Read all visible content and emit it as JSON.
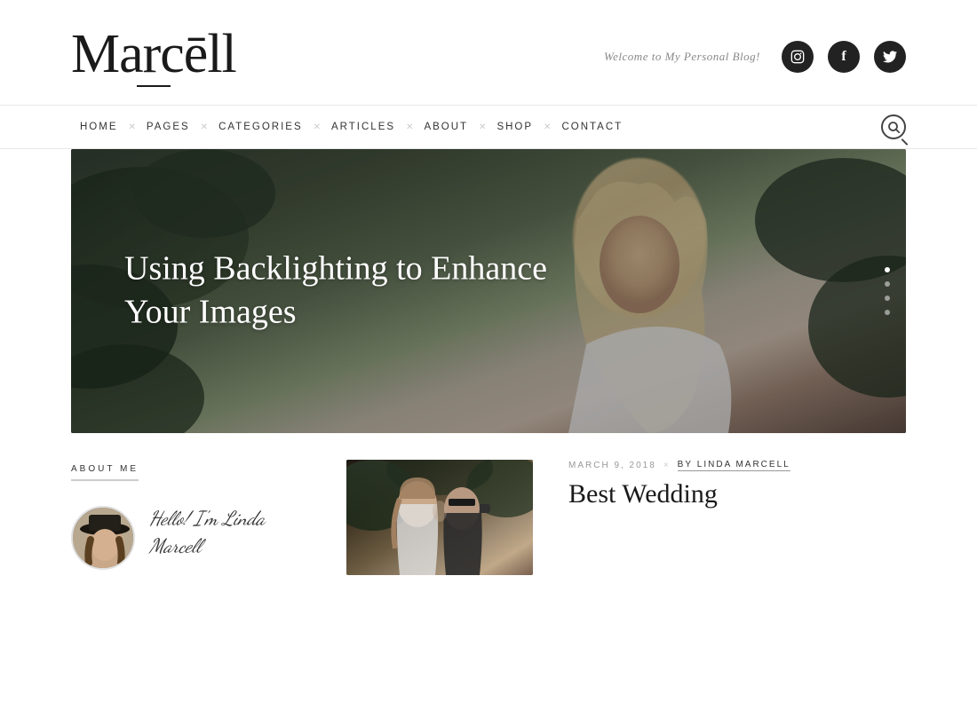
{
  "site": {
    "logo": "Marcēll",
    "tagline": "Welcome to My Personal Blog!",
    "social": [
      {
        "name": "instagram",
        "icon": "📷"
      },
      {
        "name": "facebook",
        "icon": "f"
      },
      {
        "name": "twitter",
        "icon": "🐦"
      }
    ]
  },
  "nav": {
    "items": [
      {
        "label": "HOME"
      },
      {
        "label": "PAGES"
      },
      {
        "label": "CATEGORIES"
      },
      {
        "label": "ARTICLES"
      },
      {
        "label": "ABOUT"
      },
      {
        "label": "SHOP"
      },
      {
        "label": "CONTACT"
      }
    ]
  },
  "hero": {
    "title": "Using Backlighting to Enhance Your Images",
    "dots": [
      {
        "active": true
      },
      {
        "active": false
      },
      {
        "active": false
      },
      {
        "active": false
      }
    ]
  },
  "about": {
    "label": "ABOUT ME",
    "greeting_line1": "Hello! I'm Linda",
    "greeting_line2": "Marcell"
  },
  "featured_article": {
    "date": "MARCH 9, 2018",
    "separator": "×",
    "author_prefix": "by",
    "author": "Linda Marcell",
    "title": "Best Wedding"
  }
}
